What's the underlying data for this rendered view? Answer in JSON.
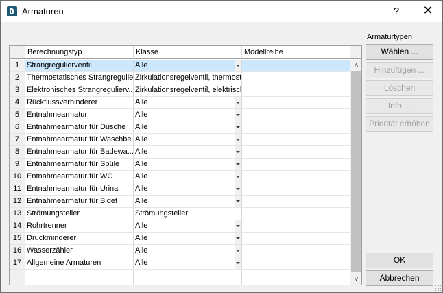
{
  "window": {
    "title": "Armaturen",
    "help_label": "?",
    "close_label": "✕"
  },
  "grid": {
    "columns": [
      "Berechnungstyp",
      "Klasse",
      "Modellreihe"
    ],
    "rows": [
      {
        "num": "1",
        "typ": "Strangregulierventil",
        "klasse": "Alle",
        "modell": "",
        "dropdown": true,
        "selected": true
      },
      {
        "num": "2",
        "typ": "Thermostatisches Strangregulie...",
        "klasse": "Zirkulationsregelventil, thermost...",
        "modell": "",
        "dropdown": false
      },
      {
        "num": "3",
        "typ": "Elektronisches Strangregulierv...",
        "klasse": "Zirkulationsregelventil, elektrisch",
        "modell": "",
        "dropdown": false
      },
      {
        "num": "4",
        "typ": "Rückflussverhinderer",
        "klasse": "Alle",
        "modell": "",
        "dropdown": true
      },
      {
        "num": "5",
        "typ": "Entnahmearmatur",
        "klasse": "Alle",
        "modell": "",
        "dropdown": true
      },
      {
        "num": "6",
        "typ": "Entnahmearmatur für Dusche",
        "klasse": "Alle",
        "modell": "",
        "dropdown": true
      },
      {
        "num": "7",
        "typ": "Entnahmearmatur für Waschbe...",
        "klasse": "Alle",
        "modell": "",
        "dropdown": true
      },
      {
        "num": "8",
        "typ": "Entnahmearmatur für Badewa...",
        "klasse": "Alle",
        "modell": "",
        "dropdown": true
      },
      {
        "num": "9",
        "typ": "Entnahmearmatur für Spüle",
        "klasse": "Alle",
        "modell": "",
        "dropdown": true
      },
      {
        "num": "10",
        "typ": "Entnahmearmatur für WC",
        "klasse": "Alle",
        "modell": "",
        "dropdown": true
      },
      {
        "num": "11",
        "typ": "Entnahmearmatur für Urinal",
        "klasse": "Alle",
        "modell": "",
        "dropdown": true
      },
      {
        "num": "12",
        "typ": "Entnahmearmatur für Bidet",
        "klasse": "Alle",
        "modell": "",
        "dropdown": true
      },
      {
        "num": "13",
        "typ": "Strömungsteiler",
        "klasse": "Strömungsteiler",
        "modell": "",
        "dropdown": false
      },
      {
        "num": "14",
        "typ": "Rohrtrenner",
        "klasse": "Alle",
        "modell": "",
        "dropdown": true
      },
      {
        "num": "15",
        "typ": "Druckminderer",
        "klasse": "Alle",
        "modell": "",
        "dropdown": true
      },
      {
        "num": "16",
        "typ": "Wasserzähler",
        "klasse": "Alle",
        "modell": "",
        "dropdown": true
      },
      {
        "num": "17",
        "typ": "Allgemeine Armaturen",
        "klasse": "Alle",
        "modell": "",
        "dropdown": true
      }
    ]
  },
  "side": {
    "label": "Armaturtypen",
    "waehlen": "Wählen ...",
    "hinzufuegen": "Hinzufügen ...",
    "loeschen": "Löschen",
    "info": "Info ...",
    "prioritaet": "Priorität erhöhen",
    "ok": "OK",
    "abbrechen": "Abbrechen"
  },
  "colors": {
    "selection": "#cce8ff",
    "window_bg": "#f0f0f0",
    "button_bg": "#e1e1e1",
    "disabled_text": "#a0a0a0"
  }
}
